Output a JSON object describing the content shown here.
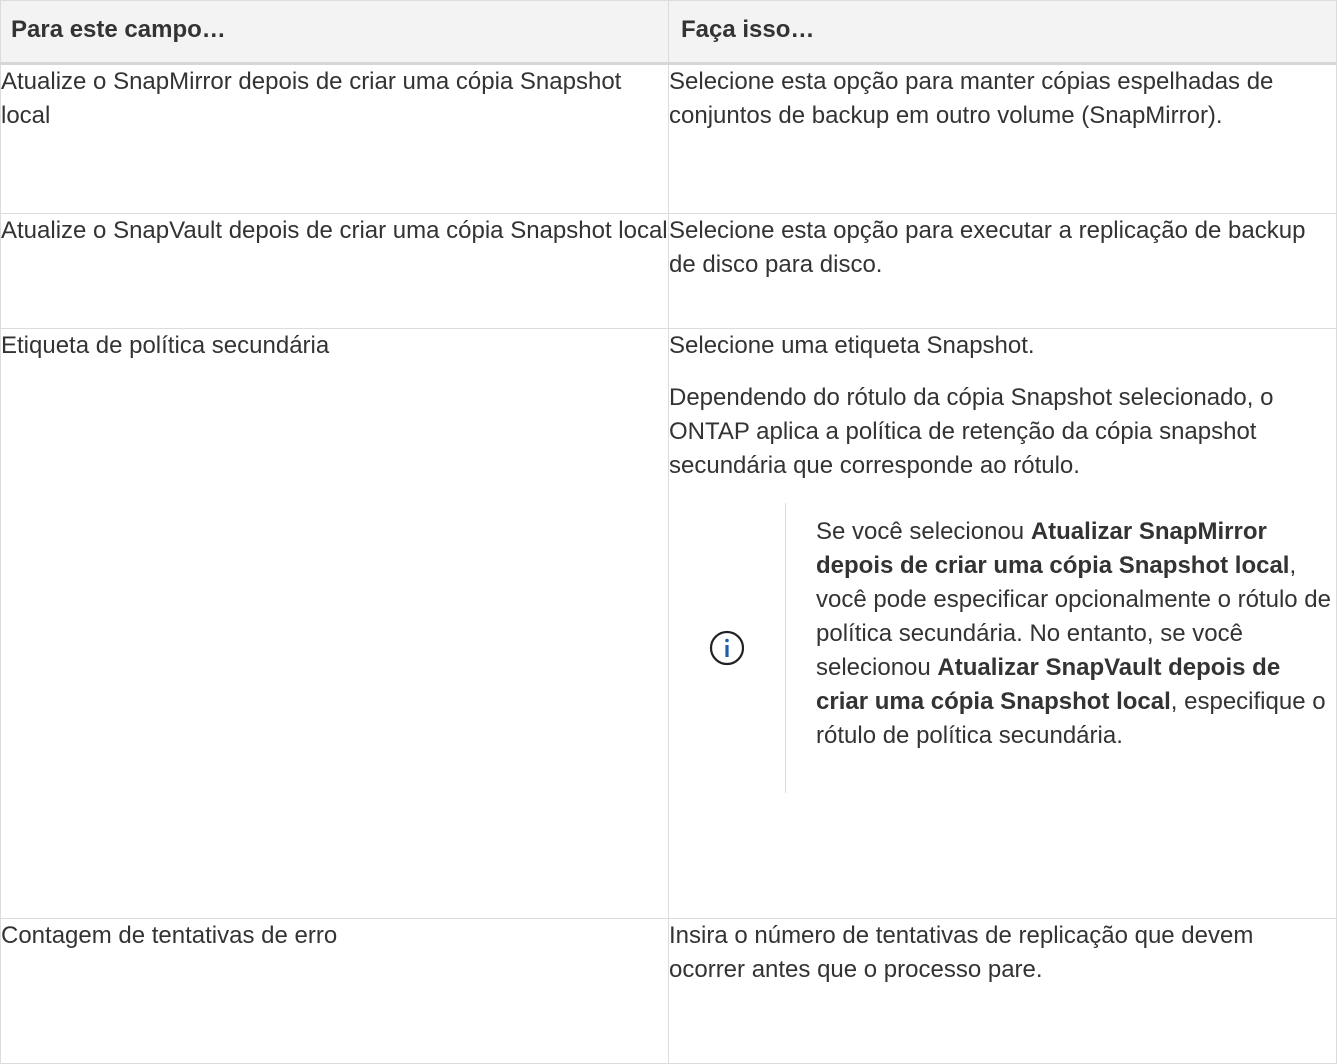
{
  "table": {
    "headers": [
      "Para este campo…",
      "Faça isso…"
    ],
    "rows": [
      {
        "field": "Atualize o SnapMirror depois de criar uma cópia Snapshot local",
        "action": "Selecione esta opção para manter cópias espelhadas de conjuntos de backup em outro volume (SnapMirror)."
      },
      {
        "field": "Atualize o SnapVault depois de criar uma cópia Snapshot local",
        "action": "Selecione esta opção para executar a replicação de backup de disco para disco."
      },
      {
        "field": "Etiqueta de política secundária",
        "action_p1": "Selecione uma etiqueta Snapshot.",
        "action_p2": "Dependendo do rótulo da cópia Snapshot selecionado, o ONTAP aplica a política de retenção da cópia snapshot secundária que corresponde ao rótulo.",
        "note": {
          "icon": "info-icon",
          "t1": "Se você selecionou ",
          "b1": "Atualizar SnapMirror depois de criar uma cópia Snapshot local",
          "t2": ", você pode especificar opcionalmente o rótulo de política secundária. No entanto, se você selecionou ",
          "b2": "Atualizar SnapVault depois de criar uma cópia Snapshot local",
          "t3": ", especifique o rótulo de política secundária."
        }
      },
      {
        "field": "Contagem de tentativas de erro",
        "action": "Insira o número de tentativas de replicação que devem ocorrer antes que o processo pare."
      }
    ]
  },
  "colors": {
    "header_bg": "#f3f3f3",
    "border": "#dcdcdc",
    "text": "#333333",
    "info_icon": "#1a5fa8"
  }
}
